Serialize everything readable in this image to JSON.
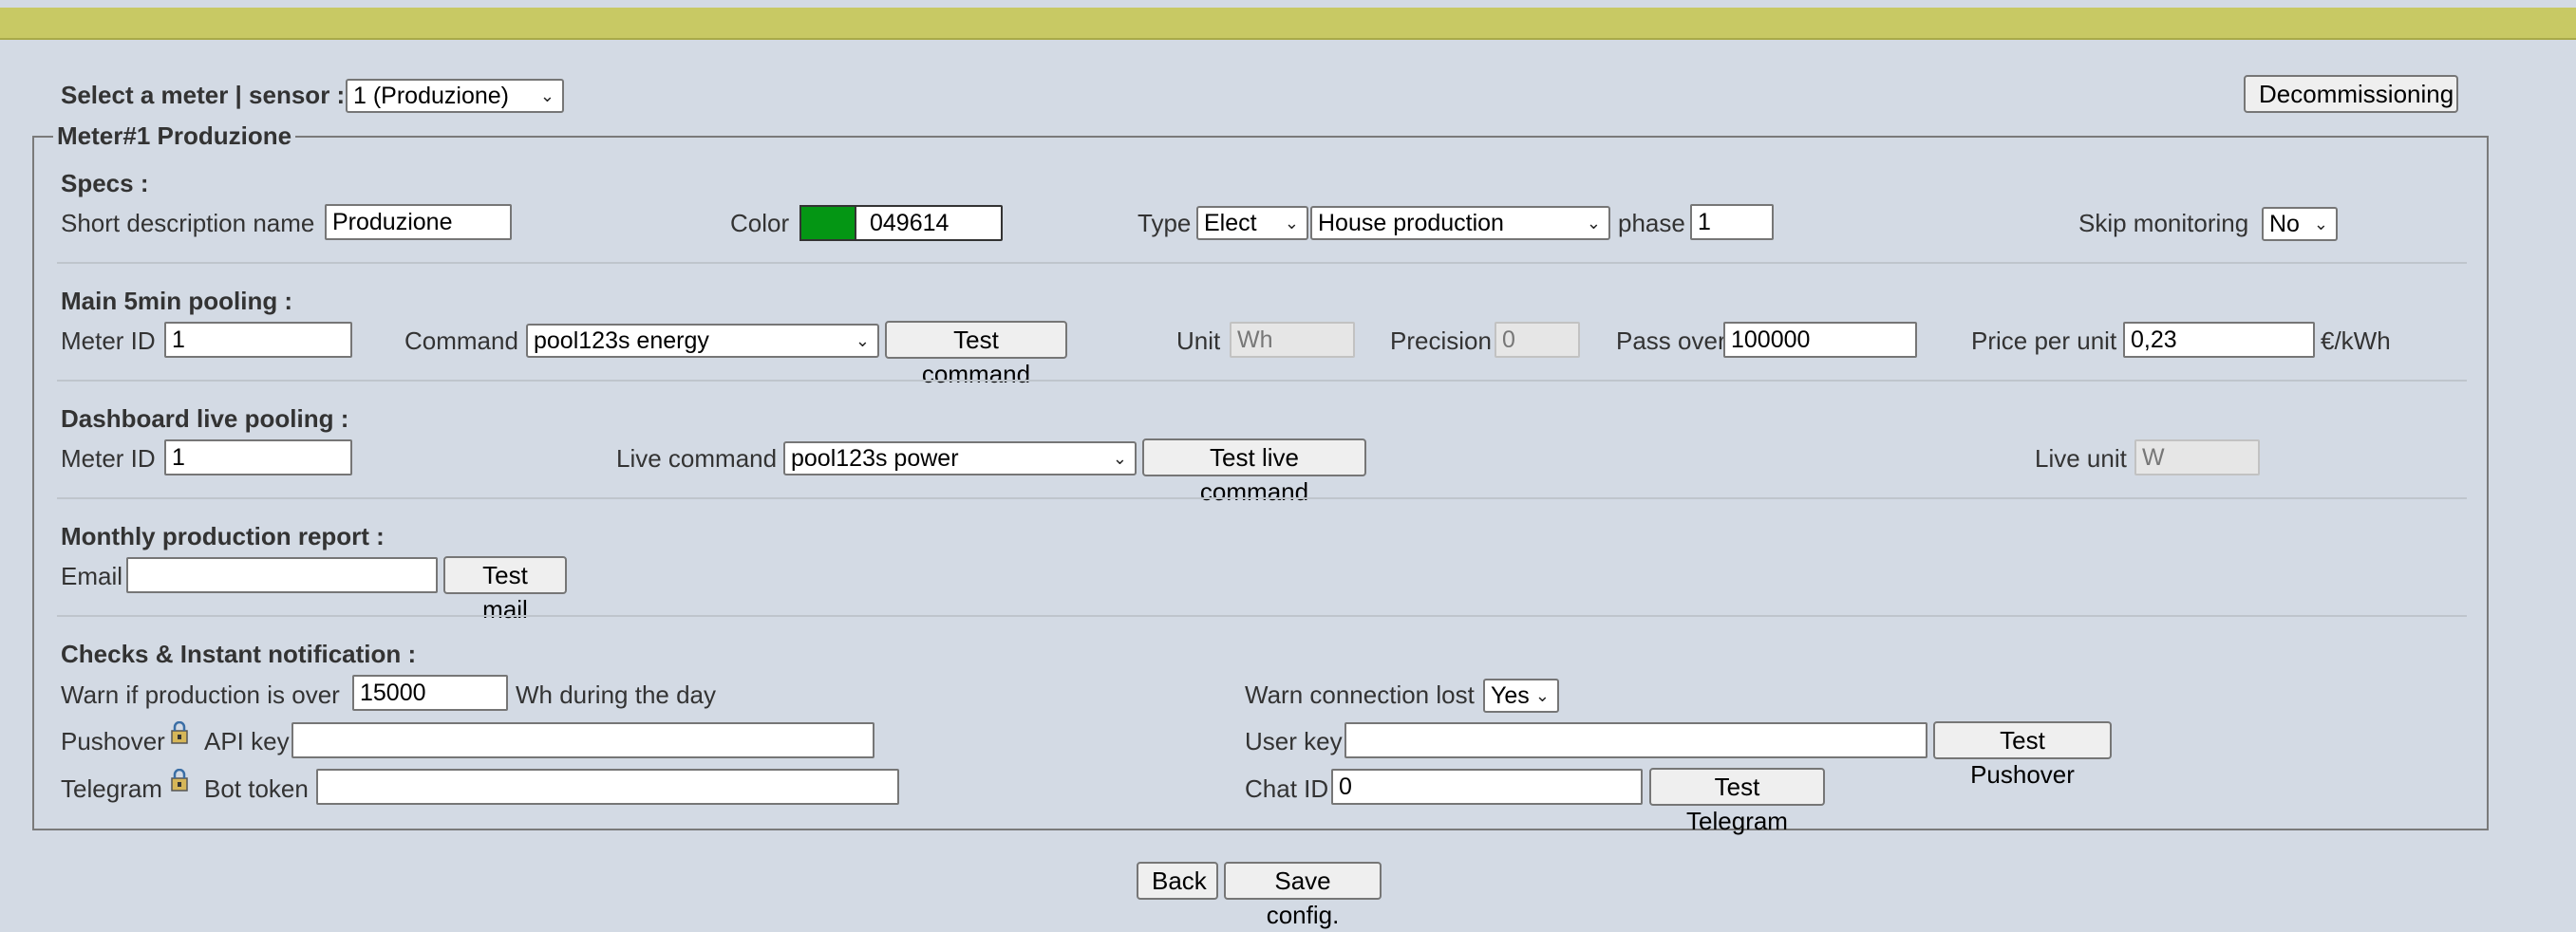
{
  "header": {
    "select_label": "Select a meter | sensor :",
    "meter_select": "1 (Produzione)",
    "decommission_button": "Decommissioning"
  },
  "meter": {
    "legend": "Meter#1 Produzione"
  },
  "specs": {
    "heading": "Specs :",
    "short_desc_label": "Short description name",
    "short_desc_value": "Produzione",
    "color_label": "Color",
    "color_value": "049614",
    "color_hex": "#049614",
    "type_label": "Type",
    "type_select": "Elect",
    "type2_select": "House production",
    "phase_label": "phase",
    "phase_value": "1",
    "skip_label": "Skip monitoring",
    "skip_select": "No"
  },
  "main_pooling": {
    "heading": "Main 5min pooling :",
    "meter_id_label": "Meter ID",
    "meter_id_value": "1",
    "command_label": "Command",
    "command_select": "pool123s energy",
    "test_command_button": "Test command",
    "unit_label": "Unit",
    "unit_value": "Wh",
    "precision_label": "Precision",
    "precision_value": "0",
    "pass_over_label": "Pass over",
    "pass_over_value": "100000",
    "price_label": "Price per unit",
    "price_value": "0,23",
    "price_unit": "€/kWh"
  },
  "live_pooling": {
    "heading": "Dashboard live pooling :",
    "meter_id_label": "Meter ID",
    "meter_id_value": "1",
    "live_command_label": "Live command",
    "live_command_select": "pool123s power",
    "test_live_button": "Test live command",
    "live_unit_label": "Live unit",
    "live_unit_value": "W"
  },
  "monthly_report": {
    "heading": "Monthly production report :",
    "email_label": "Email",
    "email_value": "",
    "test_mail_button": "Test mail"
  },
  "checks": {
    "heading": "Checks & Instant notification :",
    "warn_prod_label": "Warn if production is over",
    "warn_prod_value": "15000",
    "warn_prod_suffix": "Wh during the day",
    "warn_conn_label": "Warn connection lost",
    "warn_conn_select": "Yes",
    "pushover_label": "Pushover",
    "api_key_label": "API key",
    "api_key_value": "",
    "user_key_label": "User key",
    "user_key_value": "",
    "test_pushover_button": "Test Pushover",
    "telegram_label": "Telegram",
    "bot_token_label": "Bot token",
    "bot_token_value": "",
    "chat_id_label": "Chat ID",
    "chat_id_value": "0",
    "test_telegram_button": "Test Telegram"
  },
  "footer": {
    "back_button": "Back",
    "save_button": "Save config."
  }
}
